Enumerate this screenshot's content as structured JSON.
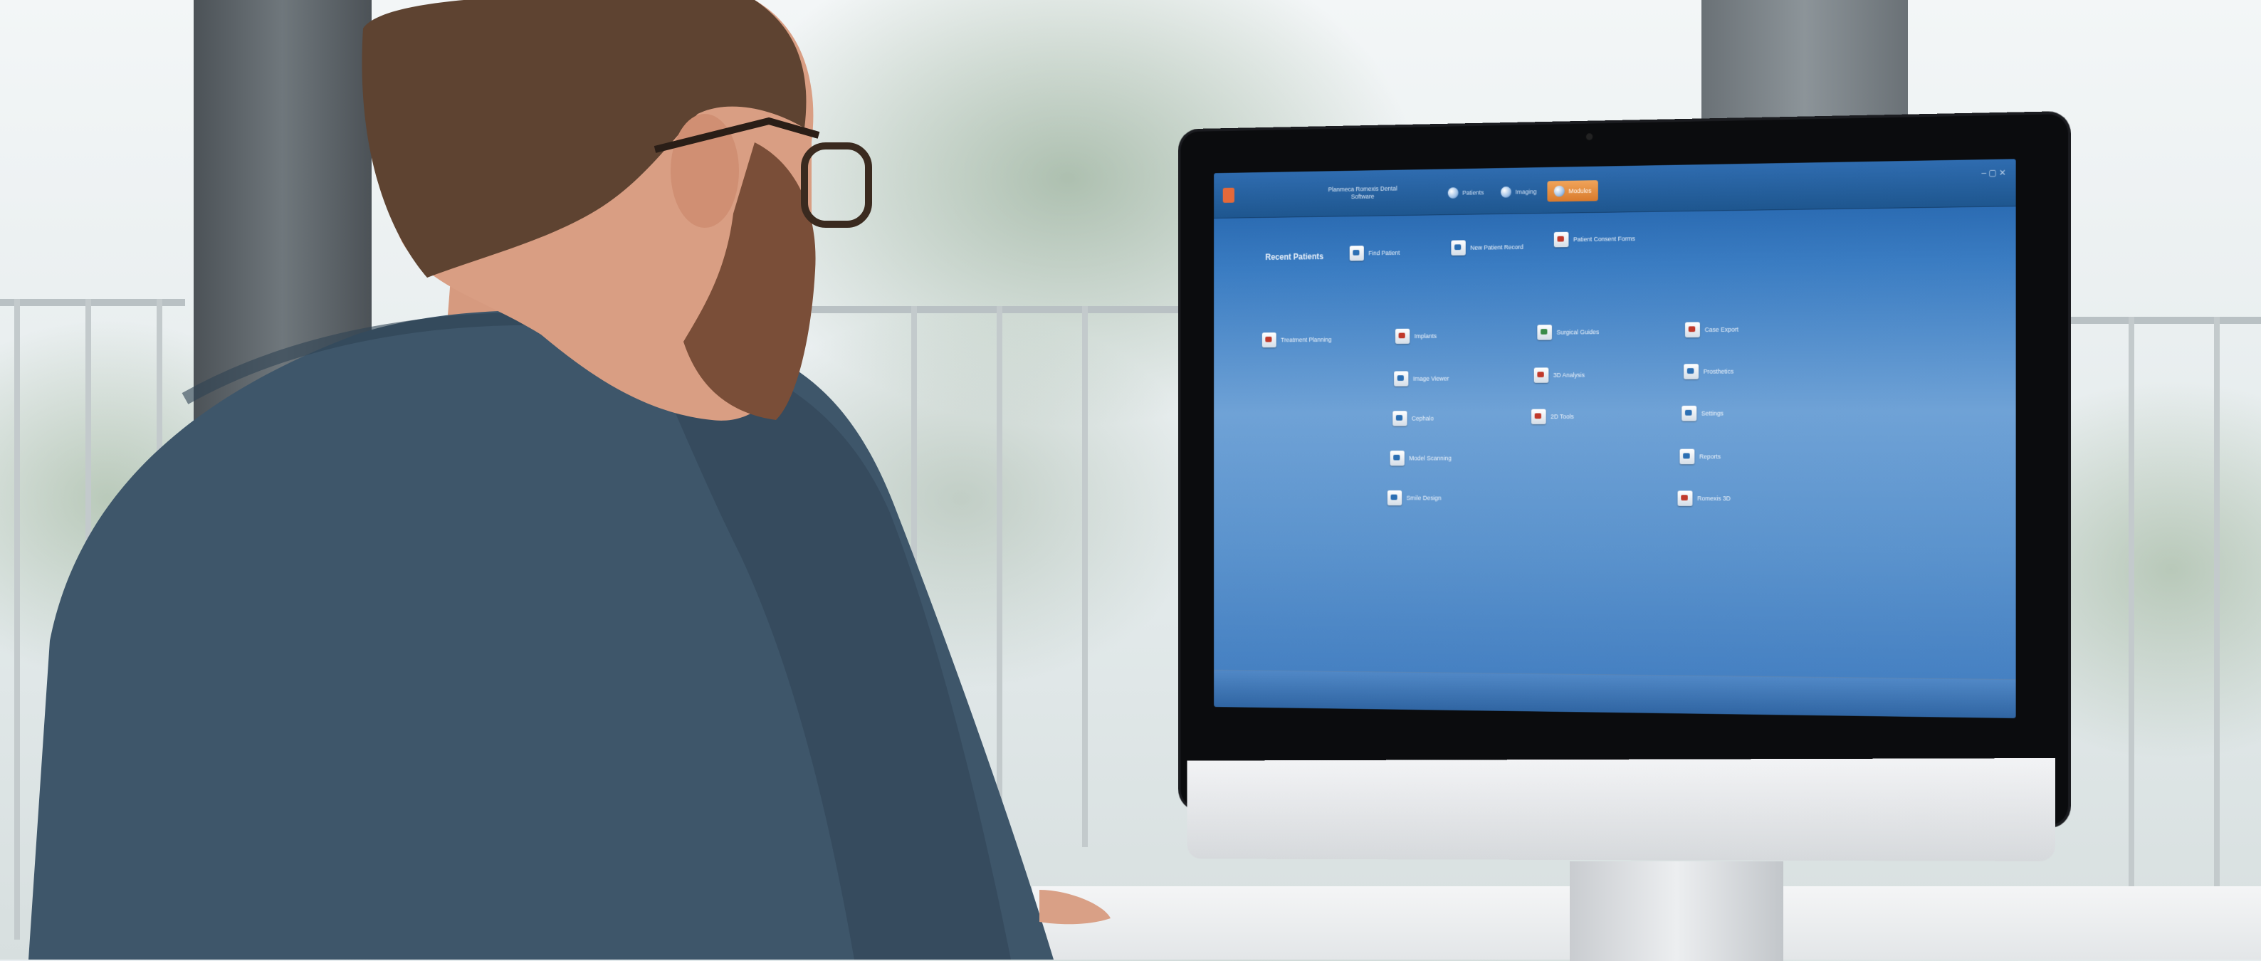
{
  "app": {
    "title": "Planmeca Romexis Dental Software",
    "nav": [
      {
        "label": "Patients",
        "active": false
      },
      {
        "label": "Imaging",
        "active": false
      },
      {
        "label": "Modules",
        "active": true
      }
    ],
    "window_controls": "– ▢ ✕"
  },
  "launcher": {
    "section_title": "Recent Patients",
    "top_tiles": [
      {
        "label": "Find Patient"
      },
      {
        "label": "New Patient Record"
      },
      {
        "label": "Patient Consent Forms"
      }
    ],
    "columns": [
      {
        "tiles": [
          {
            "label": "Treatment Planning"
          }
        ]
      },
      {
        "tiles": [
          {
            "label": "Implants"
          },
          {
            "label": "Image Viewer"
          },
          {
            "label": "Cephalo"
          },
          {
            "label": "Model Scanning"
          },
          {
            "label": "Smile Design"
          }
        ]
      },
      {
        "tiles": [
          {
            "label": "Surgical Guides"
          },
          {
            "label": "3D Analysis"
          },
          {
            "label": "2D Tools"
          }
        ]
      },
      {
        "tiles": [
          {
            "label": "Case Export"
          },
          {
            "label": "Prosthetics"
          },
          {
            "label": "Settings"
          },
          {
            "label": "Reports"
          },
          {
            "label": "Romexis 3D"
          }
        ]
      }
    ]
  },
  "colors": {
    "screen_top": "#1f5ea6",
    "screen_mid": "#6fa2d6",
    "active_nav": "#d97a2c",
    "shirt": "#3e566a"
  },
  "icons": [
    "app-logo-icon",
    "patient-icon",
    "imaging-icon",
    "modules-icon",
    "module-tile-icon"
  ]
}
